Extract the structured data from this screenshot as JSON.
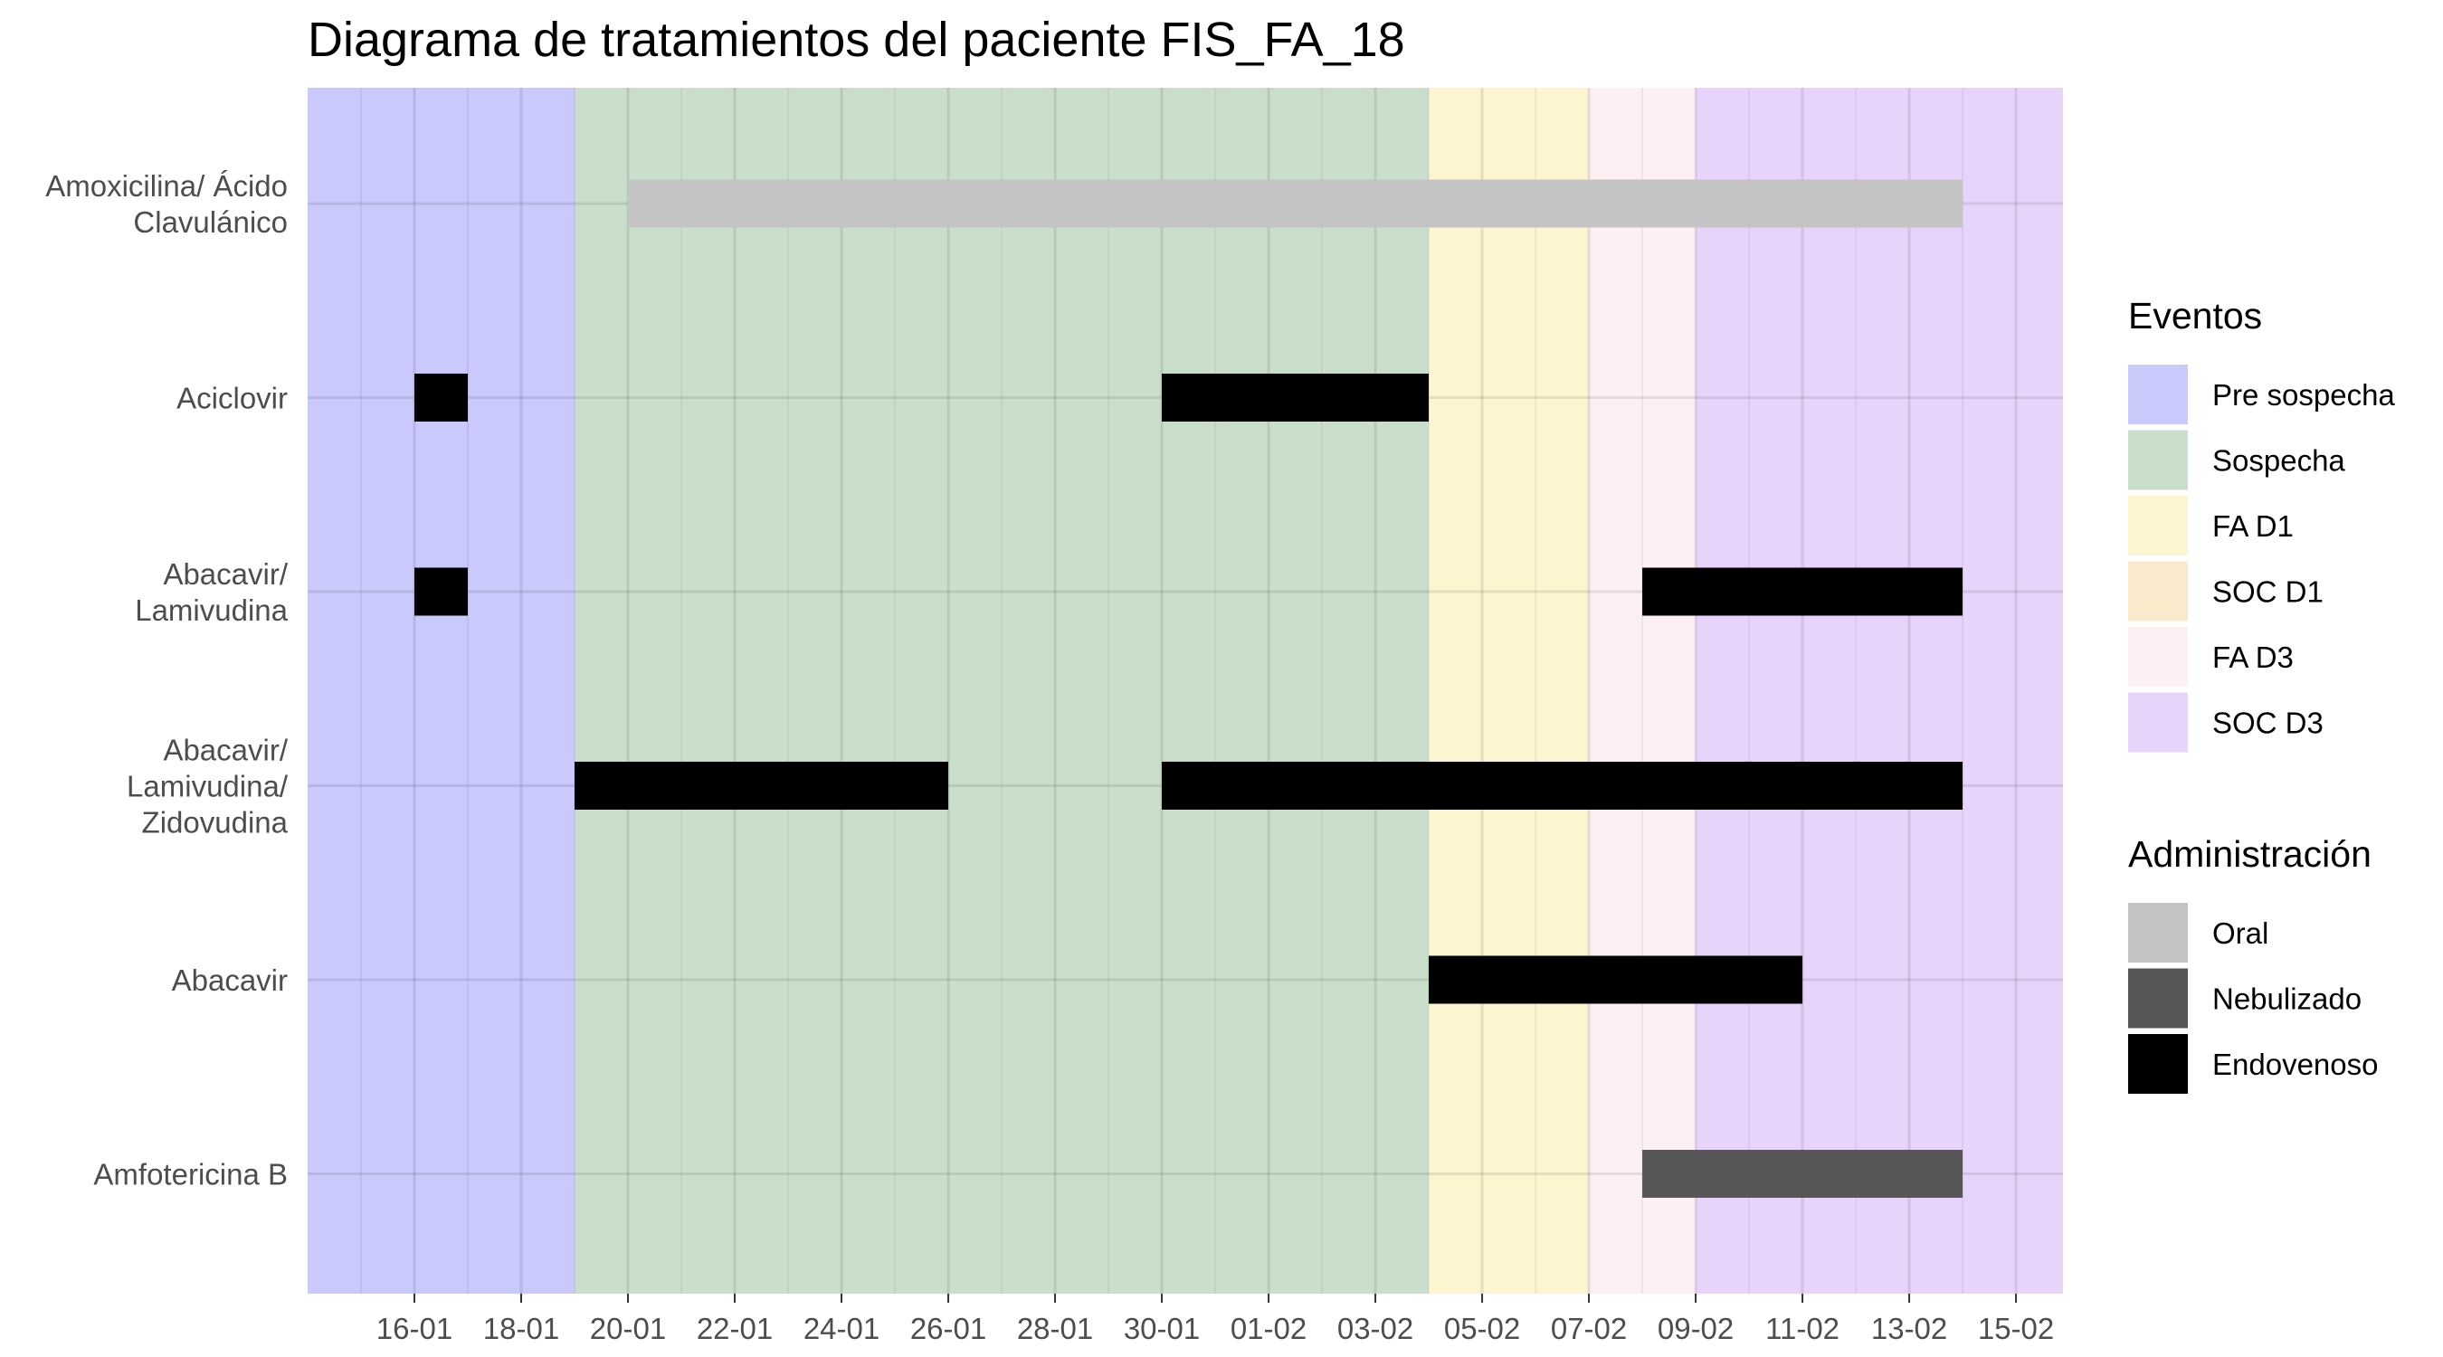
{
  "chart_data": {
    "type": "gantt",
    "title": "Diagrama de tratamientos del paciente FIS_FA_18",
    "xlabel": "",
    "ylabel": "",
    "x_axis": {
      "type": "date",
      "year": 2024,
      "range": [
        "2024-01-14",
        "2024-02-15"
      ],
      "ticks": [
        "2024-01-16",
        "2024-01-18",
        "2024-01-20",
        "2024-01-22",
        "2024-01-24",
        "2024-01-26",
        "2024-01-28",
        "2024-01-30",
        "2024-02-01",
        "2024-02-03",
        "2024-02-05",
        "2024-02-07",
        "2024-02-09",
        "2024-02-11",
        "2024-02-13",
        "2024-02-15"
      ],
      "tick_labels": [
        "16-01",
        "18-01",
        "20-01",
        "22-01",
        "24-01",
        "26-01",
        "28-01",
        "30-01",
        "01-02",
        "03-02",
        "05-02",
        "07-02",
        "09-02",
        "11-02",
        "13-02",
        "15-02"
      ]
    },
    "categories": [
      {
        "id": "amox",
        "lines": [
          "Amoxicilina/ Ácido",
          "Clavulánico"
        ]
      },
      {
        "id": "aciclovir",
        "lines": [
          "Aciclovir"
        ]
      },
      {
        "id": "abacavir_lami",
        "lines": [
          "Abacavir/",
          "Lamivudina"
        ]
      },
      {
        "id": "abacavir_lami_zido",
        "lines": [
          "Abacavir/",
          "Lamivudina/",
          "Zidovudina"
        ]
      },
      {
        "id": "abacavir",
        "lines": [
          "Abacavir"
        ]
      },
      {
        "id": "anfo",
        "lines": [
          "Amfotericina B"
        ]
      }
    ],
    "periods": [
      {
        "name": "Pre sospecha",
        "start": "2024-01-14",
        "end": "2024-01-19",
        "color": "#c9c9fb"
      },
      {
        "name": "Sospecha",
        "start": "2024-01-19",
        "end": "2024-02-04",
        "color": "#cadfcb"
      },
      {
        "name": "FA D1",
        "start": "2024-02-04",
        "end": "2024-02-07",
        "color": "#fcf5cf"
      },
      {
        "name": "SOC D1",
        "start": "2024-02-07",
        "end": "2024-02-07",
        "color": "#fbe9cc"
      },
      {
        "name": "FA D3",
        "start": "2024-02-07",
        "end": "2024-02-09",
        "color": "#fcf0f2"
      },
      {
        "name": "SOC D3",
        "start": "2024-02-09",
        "end": "2024-02-15",
        "color": "#e8d3fa"
      }
    ],
    "treatments": [
      {
        "category": "amox",
        "start": "2024-01-20",
        "end": "2024-02-14",
        "administration": "Oral"
      },
      {
        "category": "aciclovir",
        "start": "2024-01-16",
        "end": "2024-01-17",
        "administration": "Endovenoso"
      },
      {
        "category": "aciclovir",
        "start": "2024-01-30",
        "end": "2024-02-04",
        "administration": "Endovenoso"
      },
      {
        "category": "abacavir_lami",
        "start": "2024-01-16",
        "end": "2024-01-17",
        "administration": "Endovenoso"
      },
      {
        "category": "abacavir_lami",
        "start": "2024-02-08",
        "end": "2024-02-14",
        "administration": "Endovenoso"
      },
      {
        "category": "abacavir_lami_zido",
        "start": "2024-01-19",
        "end": "2024-01-26",
        "administration": "Endovenoso"
      },
      {
        "category": "abacavir_lami_zido",
        "start": "2024-01-30",
        "end": "2024-02-14",
        "administration": "Endovenoso"
      },
      {
        "category": "abacavir",
        "start": "2024-02-04",
        "end": "2024-02-11",
        "administration": "Endovenoso"
      },
      {
        "category": "anfo",
        "start": "2024-02-08",
        "end": "2024-02-14",
        "administration": "Nebulizado"
      }
    ],
    "legend_events": {
      "title": "Eventos",
      "placement": "right",
      "items": [
        {
          "label": "Pre sospecha",
          "color": "#c9c9fb"
        },
        {
          "label": "Sospecha",
          "color": "#cadfcb"
        },
        {
          "label": "FA D1",
          "color": "#fcf5cf"
        },
        {
          "label": "SOC D1",
          "color": "#fbe9cc"
        },
        {
          "label": "FA D3",
          "color": "#fcf0f2"
        },
        {
          "label": "SOC D3",
          "color": "#e8d3fa"
        }
      ]
    },
    "legend_admin": {
      "title": "Administración",
      "placement": "right",
      "items": [
        {
          "label": "Oral",
          "color": "#c4c4c4"
        },
        {
          "label": "Nebulizado",
          "color": "#575757"
        },
        {
          "label": "Endovenoso",
          "color": "#000000"
        }
      ]
    },
    "grid": true
  }
}
